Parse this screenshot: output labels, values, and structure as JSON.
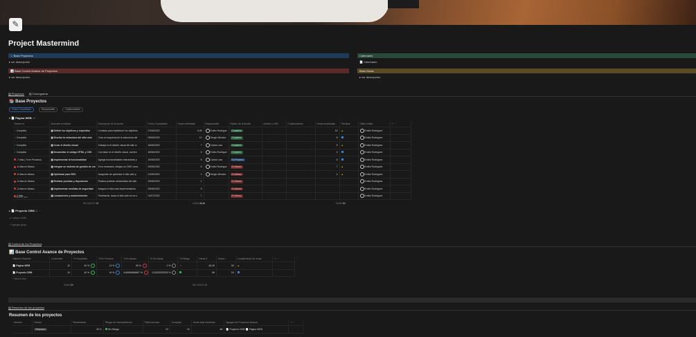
{
  "page": {
    "title": "Project Mastermind",
    "icon": "memo-icon"
  },
  "top_bars": {
    "base_proyectos": "Base Proyectos",
    "ver_descripcion_1": "ver descripción",
    "base_control": "Base Control Avance de Proyectos",
    "ver_descripcion_2": "ver descripción",
    "calendario_bar": "Calendario",
    "calendario_link": "Calendario",
    "base_notas": "Base Notas",
    "ver_descripcion_3": "ver descripción"
  },
  "tabs": [
    "Proyectos",
    "Cronograma"
  ],
  "proyectos": {
    "heading": "Base Proyectos",
    "filters": [
      "Fecha Completado",
      "Responsable",
      "Colaboradores"
    ],
    "group1": {
      "name": "Página WEB",
      "count": "11"
    },
    "columns": [
      "Tareas en",
      "Acciones a realizar",
      "Descripción de la acción",
      "Fecha Completado",
      "Horas estimadas",
      "Responsable",
      "Estado de la Acción",
      "Archivo o URL",
      "Colaboradores",
      "Horas empleadas",
      "Tiempos",
      "Último editor"
    ],
    "rows": [
      {
        "tareas": "Completo",
        "accion": "Definir los objetivos y requisitos",
        "desc": "Contacto para establecer los objetivos",
        "fecha": "07/06/2023",
        "horas": "0,45",
        "resp": "Emilio Rodrígue",
        "estado": "Completo",
        "estado_color": "green",
        "empleadas": "10",
        "tiempo": "warn",
        "editor": "Emilio Rodríguez"
      },
      {
        "tareas": "Completo",
        "accion": "Diseñar la estructura del sitio web",
        "desc": "Crea un esquema de la estructura del",
        "fecha": "09/06/2023",
        "horas": "10",
        "resp": "Sergio Méndez",
        "estado": "Completo",
        "estado_color": "green",
        "empleadas": "8",
        "tiempo": "blue",
        "editor": "Emilio Rodríguez"
      },
      {
        "tareas": "Completo",
        "accion": "Crear el diseño visual",
        "desc": "Trabaja en el diseño visual del sitio w",
        "fecha": "16/06/2023",
        "horas": "7",
        "resp": "Carlos Lara",
        "estado": "Completo",
        "estado_color": "green",
        "empleadas": "9",
        "tiempo": "warn",
        "editor": "Emilio Rodríguez"
      },
      {
        "tareas": "Completo",
        "accion": "Desarrollar el código HTML y CSS",
        "desc": "Con base en el diseño visual, comien",
        "fecha": "18/06/2023",
        "horas": "6",
        "resp": "Emilio Rodrígue",
        "estado": "Completo",
        "estado_color": "green",
        "empleadas": "4",
        "tiempo": "blue",
        "editor": "Emilio Rodríguez"
      },
      {
        "tareas": "-7 días ( % en Proceso)",
        "accion": "Implementar la funcionalidad",
        "desc": "Agrega funcionalidades interactivas y",
        "fecha": "13/06/2023",
        "horas": "8",
        "resp": "Carlos Lara",
        "estado": "En Proceso",
        "estado_color": "blue",
        "empleadas": "6",
        "tiempo": "blue",
        "editor": "Emilio Rodríguez"
      },
      {
        "tareas": "-6 días en Atraso",
        "accion": "Integrar un sistema de gestión de cor",
        "desc": "Si es necesario, integra un CMS como",
        "fecha": "20/06/2023",
        "horas": "6",
        "resp": "Emilio Rodrígue",
        "estado": "En Atraso",
        "estado_color": "red",
        "empleadas": "7",
        "tiempo": "warn",
        "editor": "Emilio Rodríguez"
      },
      {
        "tareas": "-5 días en Atraso",
        "accion": "Optimizar para SEO",
        "desc": "Asegúrate de optimizar el sitio web p",
        "fecha": "21/06/2023",
        "horas": "2",
        "resp": "Sergio Méndez",
        "estado": "En Atraso",
        "estado_color": "red",
        "empleadas": "4",
        "tiempo": "warn",
        "editor": "Emilio Rodríguez"
      },
      {
        "tareas": "-5 días en Atraso",
        "accion": "Realizar pruebas y depuración",
        "desc": "Realiza pruebas exhaustivas del sitio",
        "fecha": "23/06/2023",
        "horas": "1",
        "resp": "",
        "estado": "En Atraso",
        "estado_color": "red",
        "empleadas": "",
        "tiempo": "",
        "editor": "Emilio Rodríguez"
      },
      {
        "tareas": "-3 días en Atraso",
        "accion": "Implementar medidas de seguridad",
        "desc": "Asegura el sitio web implementando",
        "fecha": "25/06/2023",
        "horas": "5",
        "resp": "",
        "estado": "En Atraso",
        "estado_color": "red",
        "empleadas": "",
        "tiempo": "",
        "editor": "Emilio Rodríguez"
      },
      {
        "tareas": "4 días",
        "accion": "Lanzamiento y mantenimiento",
        "desc": "Finalmente, lanza el sitio web en un s",
        "fecha": "01/07/2023",
        "horas": "7",
        "resp": "",
        "estado": "En Atraso",
        "estado_color": "red",
        "empleadas": "",
        "tiempo": "",
        "editor": "Emilio Rodríguez"
      }
    ],
    "new_row": "Nuevo ítem",
    "summary": {
      "recuento_label": "RECUENTO",
      "recuento": "10",
      "suma1_label": "SUMA",
      "suma1": "46,45",
      "suma2_label": "SUMA",
      "suma2": "50"
    },
    "group2": {
      "name": "Proyecto CRM",
      "count": "11"
    },
    "grupo_oculto": "1 grupo oculto",
    "agregar_grupo": "Agregar grupo"
  },
  "control": {
    "tab": "Control de los Proyectos",
    "heading": "Base Control Avance de Proyectos",
    "columns": [
      "Objetivo Resuelto",
      "# Acciones",
      "% Completos",
      "% En Proceso",
      "% En Atraso",
      "% Sin Iniciar",
      "% Riesgo",
      "Horas E",
      "Horas I",
      "Cumplimiento de horas"
    ],
    "rows": [
      {
        "name": "Página WEB",
        "acciones": "10",
        "completos": "40 %",
        "proceso": "10 %",
        "atraso": "50 %",
        "sin_iniciar": "0 %",
        "riesgo": "x",
        "horas_e": "46,45",
        "horas_i": "50",
        "cumpl": "warn"
      },
      {
        "name": "Proyecto CRM",
        "acciones": "10",
        "completos": "40 %",
        "proceso": "40 %",
        "atraso": "6,66666666667 %",
        "sin_iniciar": "13,3333333333 %",
        "riesgo": "ok",
        "horas_e": "56",
        "horas_i": "18",
        "cumpl": "blue"
      }
    ],
    "new_row": "Nuevo ítem",
    "summary": {
      "s1_label": "SUMA",
      "s1": "20",
      "s2_label": "RECUENTO",
      "s2": "2"
    }
  },
  "resumen": {
    "tab": "Resumen de los proyectos",
    "heading": "Resumen de los proyectos",
    "columns": [
      "Nombre",
      "Estado",
      "Rendimiento",
      "Riesgo de Incumplimiento",
      "Total Acciones",
      "Completo",
      "Horas total invertidas",
      "Agregar los Proyectos Nuevos"
    ],
    "row": {
      "estado": "Resumen",
      "rendimiento": "40 %",
      "riesgo": "Sin Riesgo",
      "total": "23",
      "completo": "10",
      "horas": "68",
      "proyecto1": "Proyecto CRM",
      "proyecto2": "Página WEB"
    }
  }
}
